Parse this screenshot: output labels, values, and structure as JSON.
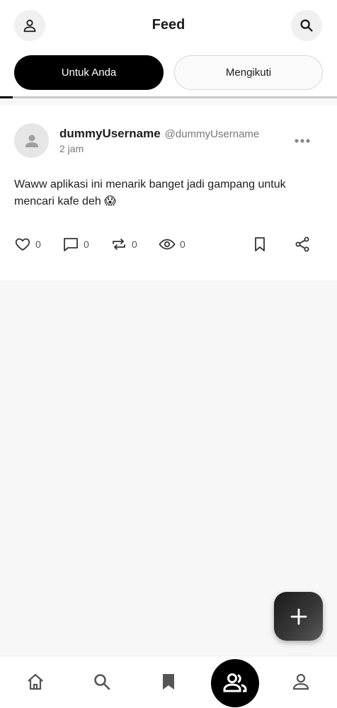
{
  "header": {
    "title": "Feed",
    "left_icon": "profile-icon",
    "right_icon": "search-icon"
  },
  "tabs": [
    {
      "label": "Untuk Anda",
      "active": true
    },
    {
      "label": "Mengikuti",
      "active": false
    }
  ],
  "post": {
    "username": "dummyUsername",
    "handle": "@dummyUsername",
    "time": "2 jam",
    "text": "Waww aplikasi ini menarik banget jadi gampang untuk mencari kafe deh 😱",
    "actions": {
      "likes": "0",
      "comments": "0",
      "reposts": "0",
      "views": "0"
    }
  },
  "bottom_nav": {
    "items": [
      "home-icon",
      "search-icon",
      "bookmark-icon",
      "community-icon",
      "profile-icon"
    ],
    "active": "community-icon"
  },
  "colors": {
    "accent": "#000000",
    "background": "#f7f7f7",
    "surface": "#ffffff"
  }
}
